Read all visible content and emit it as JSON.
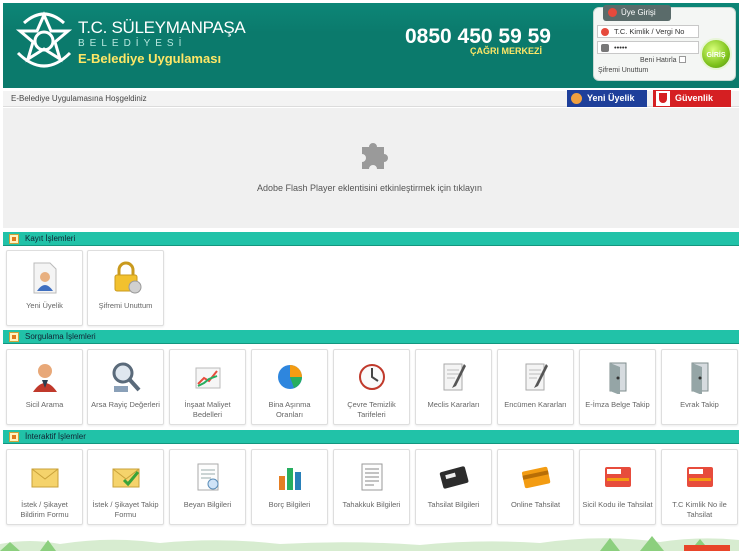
{
  "header": {
    "brand_title": "T.C. SÜLEYMANPAŞA",
    "brand_sub": "BELEDİYESİ",
    "brand_app": "E-Belediye Uygulaması",
    "phone": "0850 450 59 59",
    "call_center": "ÇAĞRI MERKEZİ",
    "colors": {
      "header_bg": "#0b7a6c",
      "accent_yellow": "#ffe766"
    }
  },
  "login": {
    "tab_label": "Üye Girişi",
    "id_value": "T.C. Kimlik / Vergi No",
    "password_value": "•••••",
    "remember_label": "Beni Hatırla",
    "forgot_label": "Şifremi Unuttum",
    "go_label": "GİRİŞ"
  },
  "welcome": {
    "text": "E-Belediye Uygulamasına Hoşgeldiniz",
    "new_member_label": "Yeni Üyelik",
    "security_label": "Güvenlik"
  },
  "flash": {
    "message": "Adobe Flash Player eklentisini etkinleştirmek için tıklayın"
  },
  "sections": {
    "kayit": {
      "label": "Kayıt İşlemleri",
      "items": [
        {
          "label": "Yeni Üyelik",
          "icon": "new-user-icon"
        },
        {
          "label": "Şifremi Unuttum",
          "icon": "lock-icon"
        }
      ]
    },
    "sorgulama": {
      "label": "Sorgulama İşlemleri",
      "items": [
        {
          "label": "Sicil Arama",
          "icon": "person-search-icon"
        },
        {
          "label": "Arsa Rayiç Değerleri",
          "icon": "magnifier-icon"
        },
        {
          "label": "İnşaat Maliyet Bedelleri",
          "icon": "chart-icon"
        },
        {
          "label": "Bina Aşınma Oranları",
          "icon": "pie-chart-icon"
        },
        {
          "label": "Çevre Temizlik Tarifeleri",
          "icon": "clock-icon"
        },
        {
          "label": "Meclis Kararları",
          "icon": "document-pen-icon"
        },
        {
          "label": "Encümen Kararları",
          "icon": "document-pen-icon"
        },
        {
          "label": "E-İmza Belge Takip",
          "icon": "door-icon"
        },
        {
          "label": "Evrak Takip",
          "icon": "door-icon"
        }
      ]
    },
    "interaktif": {
      "label": "İnteraktif İşlemler",
      "items": [
        {
          "label": "İstek / Şikayet Bildirim Formu",
          "icon": "envelope-icon"
        },
        {
          "label": "İstek / Şikayet Takip Formu",
          "icon": "envelope-check-icon"
        },
        {
          "label": "Beyan Bilgileri",
          "icon": "document-icon"
        },
        {
          "label": "Borç Bilgileri",
          "icon": "bar-chart-icon"
        },
        {
          "label": "Tahakkuk Bilgileri",
          "icon": "document-lines-icon"
        },
        {
          "label": "Tahsilat Bilgileri",
          "icon": "visa-card-icon"
        },
        {
          "label": "Online Tahsilat",
          "icon": "credit-card-icon"
        },
        {
          "label": "Sicil Kodu ile Tahsilat",
          "icon": "card-id-icon"
        },
        {
          "label": "T.C Kimlik No ile Tahsilat",
          "icon": "card-id-icon"
        }
      ]
    }
  }
}
